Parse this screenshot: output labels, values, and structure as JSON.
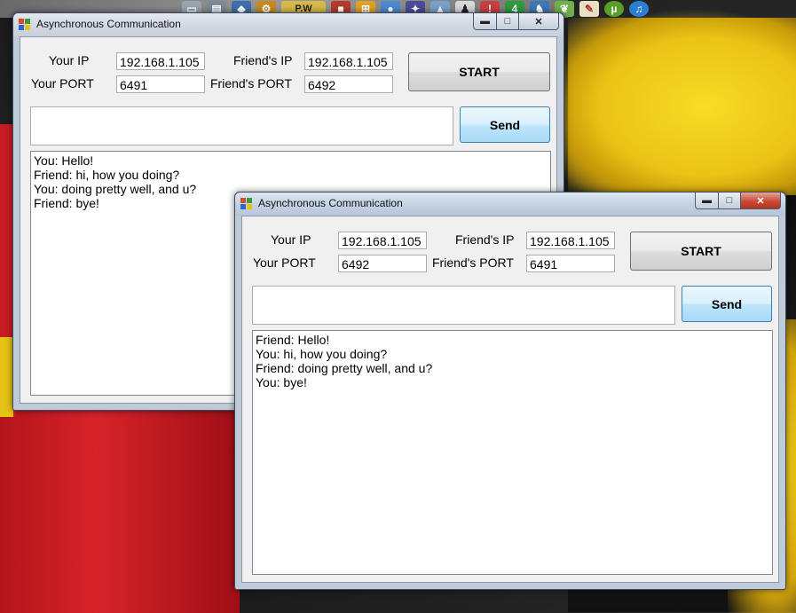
{
  "windows": [
    {
      "title": "Asynchronous Communication",
      "labels": {
        "your_ip": "Your IP",
        "your_port": "Your PORT",
        "friend_ip": "Friend's IP",
        "friend_port": "Friend's PORT"
      },
      "your_ip": "192.168.1.105",
      "your_port": "6491",
      "friend_ip": "192.168.1.105",
      "friend_port": "6492",
      "start_label": "START",
      "send_label": "Send",
      "message": "",
      "log": [
        "You: Hello!",
        "Friend: hi, how you doing?",
        "You: doing pretty well, and u?",
        "Friend: bye!"
      ]
    },
    {
      "title": "Asynchronous Communication",
      "labels": {
        "your_ip": "Your IP",
        "your_port": "Your PORT",
        "friend_ip": "Friend's IP",
        "friend_port": "Friend's PORT"
      },
      "your_ip": "192.168.1.105",
      "your_port": "6492",
      "friend_ip": "192.168.1.105",
      "friend_port": "6491",
      "start_label": "START",
      "send_label": "Send",
      "message": "",
      "log": [
        "Friend: Hello!",
        "You: hi, how you doing?",
        "Friend: doing pretty well, and u?",
        "You: bye!"
      ]
    }
  ],
  "window_controls": {
    "minimize": "▬",
    "maximize": "□",
    "close": "✕"
  },
  "tray_icons": [
    "drive-icon",
    "network-icon",
    "shield-icon",
    "settings-icon",
    "text-icon",
    "app-icon",
    "windows-icon",
    "media-icon",
    "game-icon",
    "chart-icon",
    "runner-icon",
    "warning-icon",
    "number-icon",
    "player-icon",
    "leaf-icon",
    "paint-icon",
    "utorrent-icon",
    "itunes-icon"
  ],
  "tray_labels": {
    "text-icon": "P.W",
    "number-icon": "4"
  }
}
